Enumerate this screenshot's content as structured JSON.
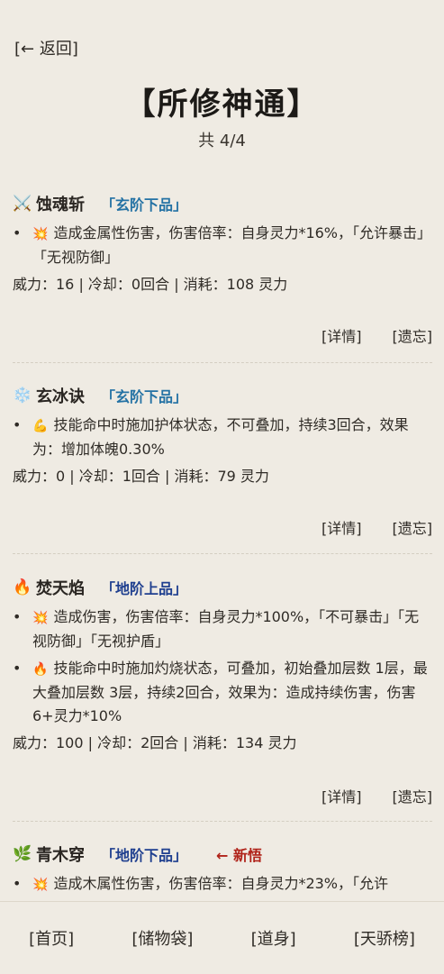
{
  "header": {
    "back_label": "[← 返回]",
    "title": "【所修神通】",
    "count": "共 4/4"
  },
  "skills": [
    {
      "icon": "⚔️",
      "name": "蚀魂斩",
      "rank": "「玄阶下品」",
      "effects": [
        {
          "icon": "💥",
          "text": "造成金属性伤害，伤害倍率：自身灵力*16%，「允许暴击」「无视防御」"
        }
      ],
      "stats": "威力：16 | 冷却：0回合 | 消耗：108 灵力",
      "detail_label": "[详情]",
      "forget_label": "[遗忘]"
    },
    {
      "icon": "❄️",
      "name": "玄冰诀",
      "rank": "「玄阶下品」",
      "effects": [
        {
          "icon": "💪",
          "text": "技能命中时施加护体状态，不可叠加，持续3回合，效果为：增加体魄0.30%"
        }
      ],
      "stats": "威力：0 | 冷却：1回合 | 消耗：79 灵力",
      "detail_label": "[详情]",
      "forget_label": "[遗忘]"
    },
    {
      "icon": "🔥",
      "name": "焚天焰",
      "rank": "「地阶上品」",
      "effects": [
        {
          "icon": "💥",
          "text": "造成伤害，伤害倍率：自身灵力*100%，「不可暴击」「无视防御」「无视护盾」"
        },
        {
          "icon": "🔥",
          "text": "技能命中时施加灼烧状态，可叠加，初始叠加层数 1层，最大叠加层数 3层，持续2回合，效果为：造成持续伤害，伤害6+灵力*10%"
        }
      ],
      "stats": "威力：100 | 冷却：2回合 | 消耗：134 灵力",
      "detail_label": "[详情]",
      "forget_label": "[遗忘]"
    },
    {
      "icon": "🌿",
      "name": "青木穿",
      "rank": "「地阶下品」",
      "new_tag": "← 新悟",
      "effects": [
        {
          "icon": "💥",
          "text": "造成木属性伤害，伤害倍率：自身灵力*23%，「允许"
        }
      ]
    }
  ],
  "nav": {
    "home": "[首页]",
    "storage": "[储物袋]",
    "body": "[道身]",
    "ranking": "[天骄榜]"
  },
  "colors": {
    "background": "#efebe3",
    "rank_xuan": "#2472a4",
    "rank_di": "#1f3f8f",
    "new_tag": "#b0231a"
  }
}
